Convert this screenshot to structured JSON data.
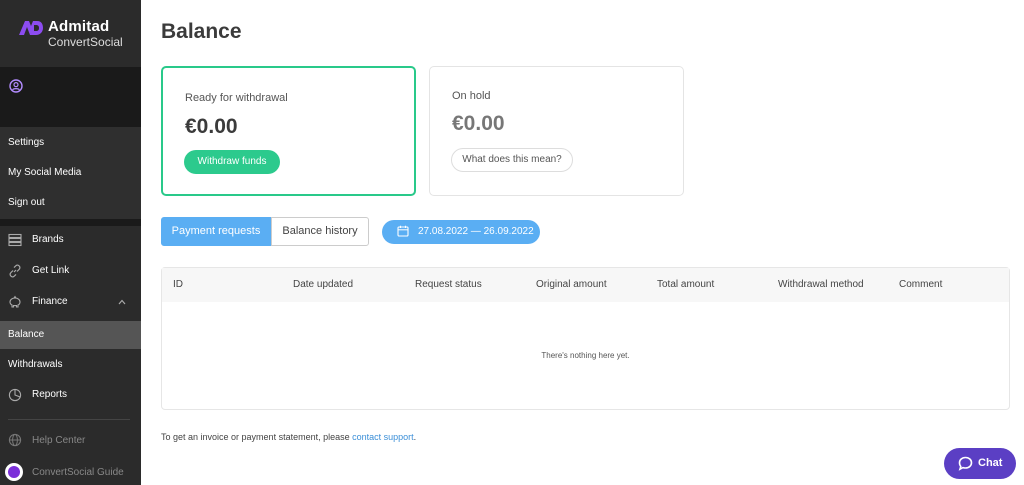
{
  "sidebar": {
    "logo": {
      "title": "Admitad",
      "subtitle": "ConvertSocial",
      "mark": "AD"
    },
    "profile_icon": "user-circle-icon",
    "account_menu": [
      {
        "label": "Settings"
      },
      {
        "label": "My Social Media"
      },
      {
        "label": "Sign out"
      }
    ],
    "nav": {
      "brands": {
        "label": "Brands",
        "icon": "layers-icon"
      },
      "get_link": {
        "label": "Get Link",
        "icon": "link-icon"
      },
      "finance": {
        "label": "Finance",
        "icon": "piggy-bank-icon",
        "expanded": true
      },
      "balance": {
        "label": "Balance",
        "active": true
      },
      "withdrawals": {
        "label": "Withdrawals"
      },
      "reports": {
        "label": "Reports",
        "icon": "pie-chart-icon"
      }
    },
    "bottom": {
      "help": {
        "label": "Help Center",
        "icon": "globe-icon"
      },
      "guide": {
        "label": "ConvertSocial Guide",
        "icon": "guide-icon"
      }
    }
  },
  "main": {
    "title": "Balance",
    "ready": {
      "label": "Ready for withdrawal",
      "amount": "€0.00",
      "button": "Withdraw funds"
    },
    "hold": {
      "label": "On hold",
      "amount": "€0.00",
      "button": "What does this mean?"
    },
    "tabs": [
      {
        "label": "Payment requests",
        "active": true
      },
      {
        "label": "Balance history",
        "active": false
      }
    ],
    "date_range": "27.08.2022 — 26.09.2022",
    "table": {
      "columns": [
        "ID",
        "Date updated",
        "Request status",
        "Original amount",
        "Total amount",
        "Withdrawal method",
        "Comment"
      ],
      "empty_text": "There's nothing here yet."
    },
    "footer": {
      "text": "To get an invoice or payment statement, please ",
      "link": "contact support",
      "end": "."
    }
  },
  "chat": {
    "label": "Chat"
  },
  "colors": {
    "sidebar": "#2b2b2b",
    "green": "#2cca8d",
    "blue": "#5aaef3",
    "purple": "#5b3fc4",
    "brand": "#7b2fd9"
  }
}
